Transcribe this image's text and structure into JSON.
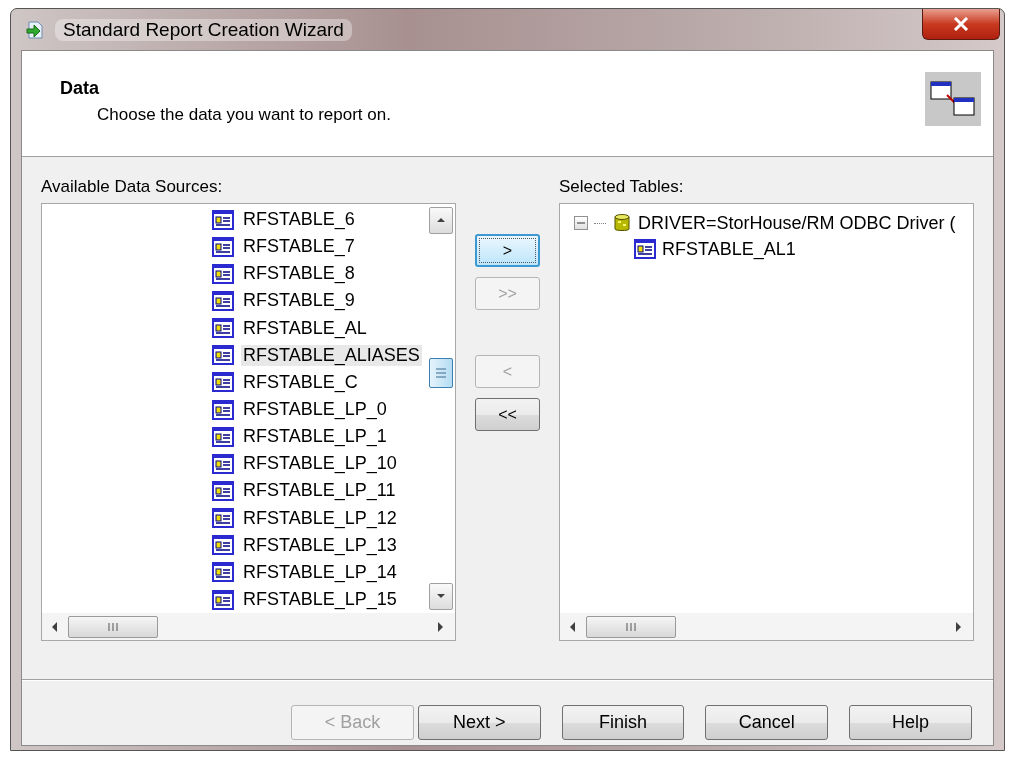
{
  "window": {
    "title": "Standard Report Creation Wizard"
  },
  "header": {
    "title": "Data",
    "subtitle": "Choose the data you want to report on."
  },
  "available": {
    "label": "Available Data Sources:",
    "items": [
      {
        "name": "RFSTABLE_6",
        "selected": false
      },
      {
        "name": "RFSTABLE_7",
        "selected": false
      },
      {
        "name": "RFSTABLE_8",
        "selected": false
      },
      {
        "name": "RFSTABLE_9",
        "selected": false
      },
      {
        "name": "RFSTABLE_AL",
        "selected": false
      },
      {
        "name": "RFSTABLE_ALIASES",
        "selected": true
      },
      {
        "name": "RFSTABLE_C",
        "selected": false
      },
      {
        "name": "RFSTABLE_LP_0",
        "selected": false
      },
      {
        "name": "RFSTABLE_LP_1",
        "selected": false
      },
      {
        "name": "RFSTABLE_LP_10",
        "selected": false
      },
      {
        "name": "RFSTABLE_LP_11",
        "selected": false
      },
      {
        "name": "RFSTABLE_LP_12",
        "selected": false
      },
      {
        "name": "RFSTABLE_LP_13",
        "selected": false
      },
      {
        "name": "RFSTABLE_LP_14",
        "selected": false
      },
      {
        "name": "RFSTABLE_LP_15",
        "selected": false
      }
    ]
  },
  "move_buttons": [
    {
      "label": ">",
      "disabled": false,
      "default": true
    },
    {
      "label": ">>",
      "disabled": true,
      "default": false
    },
    {
      "label": "<",
      "disabled": true,
      "default": false
    },
    {
      "label": "<<",
      "disabled": false,
      "default": false
    }
  ],
  "selected_tables": {
    "label": "Selected Tables:",
    "tree": [
      {
        "name": "DRIVER=StorHouse/RM ODBC Driver (",
        "kind": "database",
        "expanded": true,
        "children": [
          {
            "name": "RFSTABLE_AL1",
            "kind": "table"
          }
        ]
      }
    ]
  },
  "buttons": [
    {
      "label": "< Back",
      "disabled": true
    },
    {
      "label": "Next >",
      "disabled": false
    },
    {
      "label": "Finish",
      "disabled": false
    },
    {
      "label": "Cancel",
      "disabled": false
    },
    {
      "label": "Help",
      "disabled": false
    }
  ]
}
